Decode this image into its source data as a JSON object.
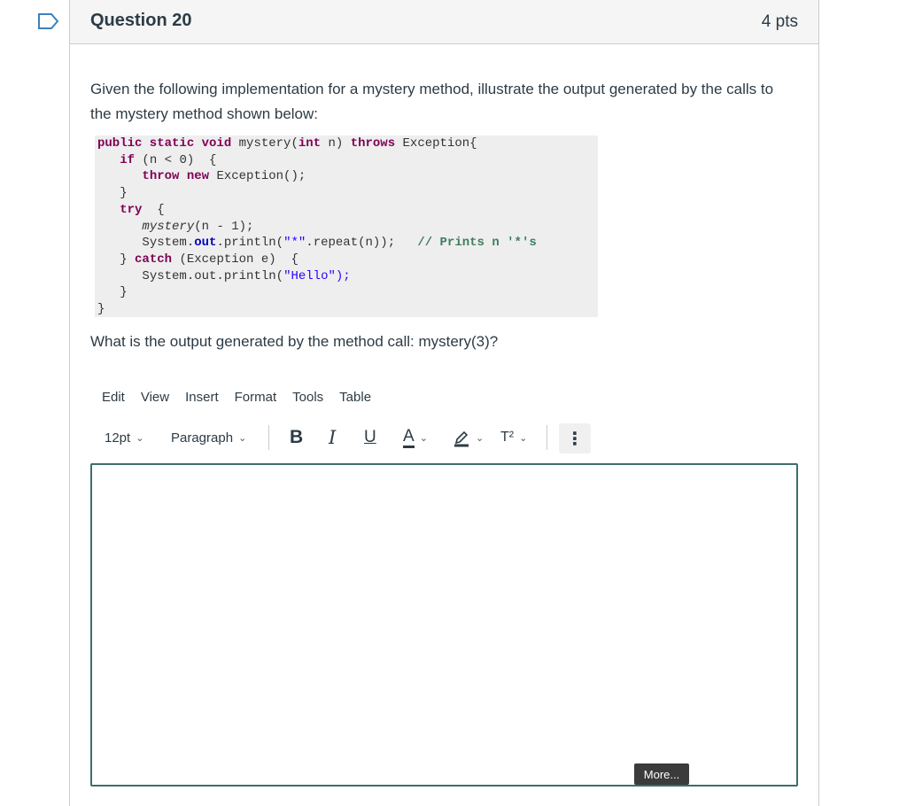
{
  "question": {
    "title": "Question 20",
    "points": "4 pts",
    "prompt": "Given the following implementation for a mystery method, illustrate the output generated by the calls to the mystery method shown below:",
    "call_question": "What is the output generated by the method call: mystery(3)?"
  },
  "code": {
    "line1_kw1": "public static void",
    "line1_a": " mystery(",
    "line1_kw2": "int",
    "line1_b": " n) ",
    "line1_kw3": "throws",
    "line1_c": " Exception{",
    "line2_kw": "if",
    "line2_a": " (n < 0)  {",
    "line3_kw": "throw new",
    "line3_a": " Exception();",
    "line4": "}",
    "line5_kw": "try",
    "line5_a": "  {",
    "line6_a": "mystery",
    "line6_b": "(n - 1);",
    "line7_a": "System.",
    "line7_fld": "out",
    "line7_b": ".println(",
    "line7_str": "\"*\"",
    "line7_c": ".repeat(n));   ",
    "line7_cmt": "// Prints n '*'s",
    "line8_a": "} ",
    "line8_kw": "catch",
    "line8_b": " (Exception e)  {",
    "line9_a": "System.out.println(",
    "line9_str": "\"Hello\");",
    "line10": "}",
    "line11": "}"
  },
  "editor": {
    "menu": [
      "Edit",
      "View",
      "Insert",
      "Format",
      "Tools",
      "Table"
    ],
    "font_size": "12pt",
    "block_format": "Paragraph",
    "bold": "B",
    "italic": "I",
    "underline": "U",
    "text_color": "A",
    "superscript": "T²",
    "more_toolbar": "⋮",
    "more_button": "More..."
  },
  "colors": {
    "editor_border": "#3c6e6c",
    "flag_icon": "#3f7fbf"
  }
}
